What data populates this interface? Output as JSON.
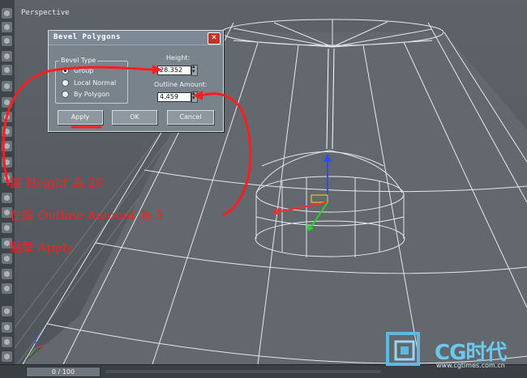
{
  "viewport": {
    "label": "Perspective"
  },
  "dialog": {
    "title": "Bevel Polygons",
    "close_glyph": "✕",
    "bevel_type": {
      "legend": "Bevel Type",
      "options": [
        {
          "label": "Group",
          "selected": true
        },
        {
          "label": "Local Normal",
          "selected": false
        },
        {
          "label": "By Polygon",
          "selected": false
        }
      ]
    },
    "height": {
      "label": "Height:",
      "value": "28.352"
    },
    "outline_amount": {
      "label": "Outline Amount:",
      "value": "4.459"
    },
    "buttons": {
      "apply": "Apply",
      "ok": "OK",
      "cancel": "Cancel"
    }
  },
  "annotations": {
    "line1": "設 Height 為 28",
    "line2": "在設 Outline Amount 為 5",
    "line3": "點擊 Apply",
    "color": "#ff1e1e"
  },
  "statusbar": {
    "frame_slider": "0 / 100"
  },
  "watermark": {
    "text": "CG时代",
    "url": "www.cgtimes.com.cn"
  },
  "icons": [
    "toolbar-icons",
    "close-icon",
    "radio-icon",
    "spinner-arrows-icon",
    "transform-gizmo-icon",
    "axis-tripod-icon",
    "cg-logo-icon"
  ]
}
